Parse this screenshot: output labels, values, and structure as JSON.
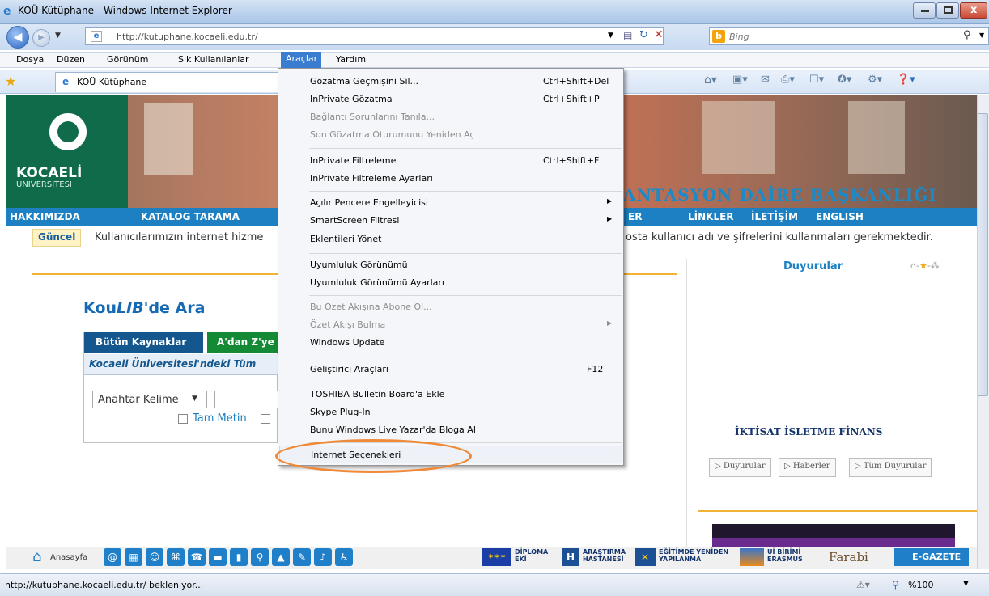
{
  "window": {
    "title": "KOÜ Kütüphane - Windows Internet Explorer"
  },
  "address_bar": {
    "url": "http://kutuphane.kocaeli.edu.tr/",
    "search_placeholder": "Bing"
  },
  "menu_bar": {
    "items": [
      "Dosya",
      "Düzen",
      "Görünüm",
      "Sık Kullanılanlar",
      "Araçlar",
      "Yardım"
    ]
  },
  "favorites": {
    "tab_title": "KOÜ Kütüphane"
  },
  "tools_menu": {
    "items": [
      {
        "label": "Gözatma Geçmişini Sil...",
        "shortcut": "Ctrl+Shift+Del",
        "enabled": true
      },
      {
        "label": "InPrivate Gözatma",
        "shortcut": "Ctrl+Shift+P",
        "enabled": true
      },
      {
        "label": "Bağlantı Sorunlarını Tanıla...",
        "shortcut": "",
        "enabled": false
      },
      {
        "label": "Son Gözatma Oturumunu Yeniden Aç",
        "shortcut": "",
        "enabled": false
      },
      {
        "label": "InPrivate Filtreleme",
        "shortcut": "Ctrl+Shift+F",
        "enabled": true
      },
      {
        "label": "InPrivate Filtreleme Ayarları",
        "shortcut": "",
        "enabled": true
      },
      {
        "label": "Açılır Pencere Engelleyicisi",
        "shortcut": "",
        "enabled": true
      },
      {
        "label": "SmartScreen Filtresi",
        "shortcut": "",
        "enabled": true
      },
      {
        "label": "Eklentileri Yönet",
        "shortcut": "",
        "enabled": true
      },
      {
        "label": "Uyumluluk Görünümü",
        "shortcut": "",
        "enabled": true
      },
      {
        "label": "Uyumluluk Görünümü Ayarları",
        "shortcut": "",
        "enabled": true
      },
      {
        "label": "Bu Özet Akışına Abone Ol...",
        "shortcut": "",
        "enabled": false
      },
      {
        "label": "Özet Akışı Bulma",
        "shortcut": "",
        "enabled": false
      },
      {
        "label": "Windows Update",
        "shortcut": "",
        "enabled": true
      },
      {
        "label": "Geliştirici Araçları",
        "shortcut": "F12",
        "enabled": true
      },
      {
        "label": "TOSHIBA Bulletin Board'a Ekle",
        "shortcut": "",
        "enabled": true
      },
      {
        "label": "Skype Plug-In",
        "shortcut": "",
        "enabled": true
      },
      {
        "label": "Bunu Windows Live Yazar'da Bloga Al",
        "shortcut": "",
        "enabled": true
      },
      {
        "label": "Internet Seçenekleri",
        "shortcut": "",
        "enabled": true
      }
    ]
  },
  "site": {
    "logo_name": "KOCAELİ",
    "logo_sub": "ÜNİVERSİTESİ",
    "department": "ANTASYON DAİRE BAŞKANLIĞI",
    "nav": [
      "HAKKIMIZDA",
      "KATALOG TARAMA",
      "ER",
      "LİNKLER",
      "İLETİŞİM",
      "ENGLISH"
    ],
    "ticker_tag": "Güncel",
    "ticker_left": "Kullanıcılarımızın internet hizme",
    "ticker_right": "osta kullanıcı adı ve şifrelerini kullanmaları gerekmektedir.",
    "search_title_pre": "Kou",
    "search_title_em": "LIB",
    "search_title_post": "'de Ara",
    "tab_all": "Bütün Kaynaklar",
    "tab_az": "A'dan Z'ye",
    "strip_text": "Kocaeli Üniversitesi'ndeki Tüm",
    "keyword_select": "Anahtar Kelime",
    "checkbox_label": "Tam Metin",
    "announcements_title": "Duyurular",
    "announcement_item": "İKTİSAT İSLETME FİNANS",
    "btn_duyurular": "Duyurular",
    "btn_haberler": "Haberler",
    "btn_tum": "Tüm Duyurular"
  },
  "bottom_bar": {
    "home": "Anasayfa",
    "diploma": "DİPLOMA EKİ",
    "arastirma": "ARAŞTIRMA HASTANESİ",
    "egitim": "EĞİTİMDE YENİDEN YAPILANMA",
    "ui_birimi": "Uİ BİRİMİ ERASMUS",
    "farabi": "Farabi",
    "egazete": "E-GAZETE"
  },
  "status_bar": {
    "text": "http://kutuphane.kocaeli.edu.tr/ bekleniyor...",
    "zoom": "%100"
  }
}
